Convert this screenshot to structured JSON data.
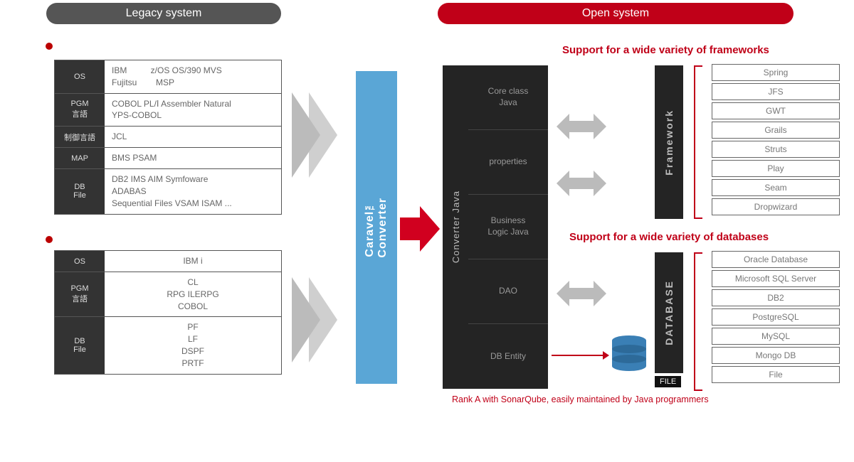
{
  "headers": {
    "legacy": "Legacy system",
    "open": "Open system"
  },
  "legacy1": {
    "rows": [
      {
        "label": "OS",
        "value": "IBM          z/OS OS/390 MVS\nFujitsu        MSP"
      },
      {
        "label": "PGM\n言語",
        "value": "COBOL PL/Ⅰ Assembler Natural\nYPS-COBOL"
      },
      {
        "label": "制御言語",
        "value": "JCL"
      },
      {
        "label": "MAP",
        "value": "BMS PSAM"
      },
      {
        "label": "DB\nFile",
        "value": "DB2 IMS AIM Symfoware\nADABAS\nSequential Files VSAM ISAM ..."
      }
    ]
  },
  "legacy2": {
    "rows": [
      {
        "label": "OS",
        "value": "IBM i"
      },
      {
        "label": "PGM\n言語",
        "value": "CL\nRPG ILERPG\nCOBOL"
      },
      {
        "label": "DB\nFile",
        "value": "PF\nLF\nDSPF\nPRTF"
      }
    ]
  },
  "caravel": "Caravel™\nConverter",
  "converter_java": "Converter Java",
  "stack": [
    "Core class\nJava",
    "properties",
    "Business\nLogic Java",
    "DAO",
    "DB Entity"
  ],
  "framework": {
    "label": "Framework",
    "head": "Support for a wide variety of frameworks",
    "items": [
      "Spring",
      "JFS",
      "GWT",
      "Grails",
      "Struts",
      "Play",
      "Seam",
      "Dropwizard"
    ]
  },
  "database": {
    "label": "DATABASE",
    "head": "Support for a wide variety of databases",
    "items": [
      "Oracle Database",
      "Microsoft SQL Server",
      "DB2",
      "PostgreSQL",
      "MySQL",
      "Mongo DB",
      "File"
    ]
  },
  "file_chip": "FILE",
  "footnote": "Rank A with SonarQube, easily maintained by Java programmers"
}
